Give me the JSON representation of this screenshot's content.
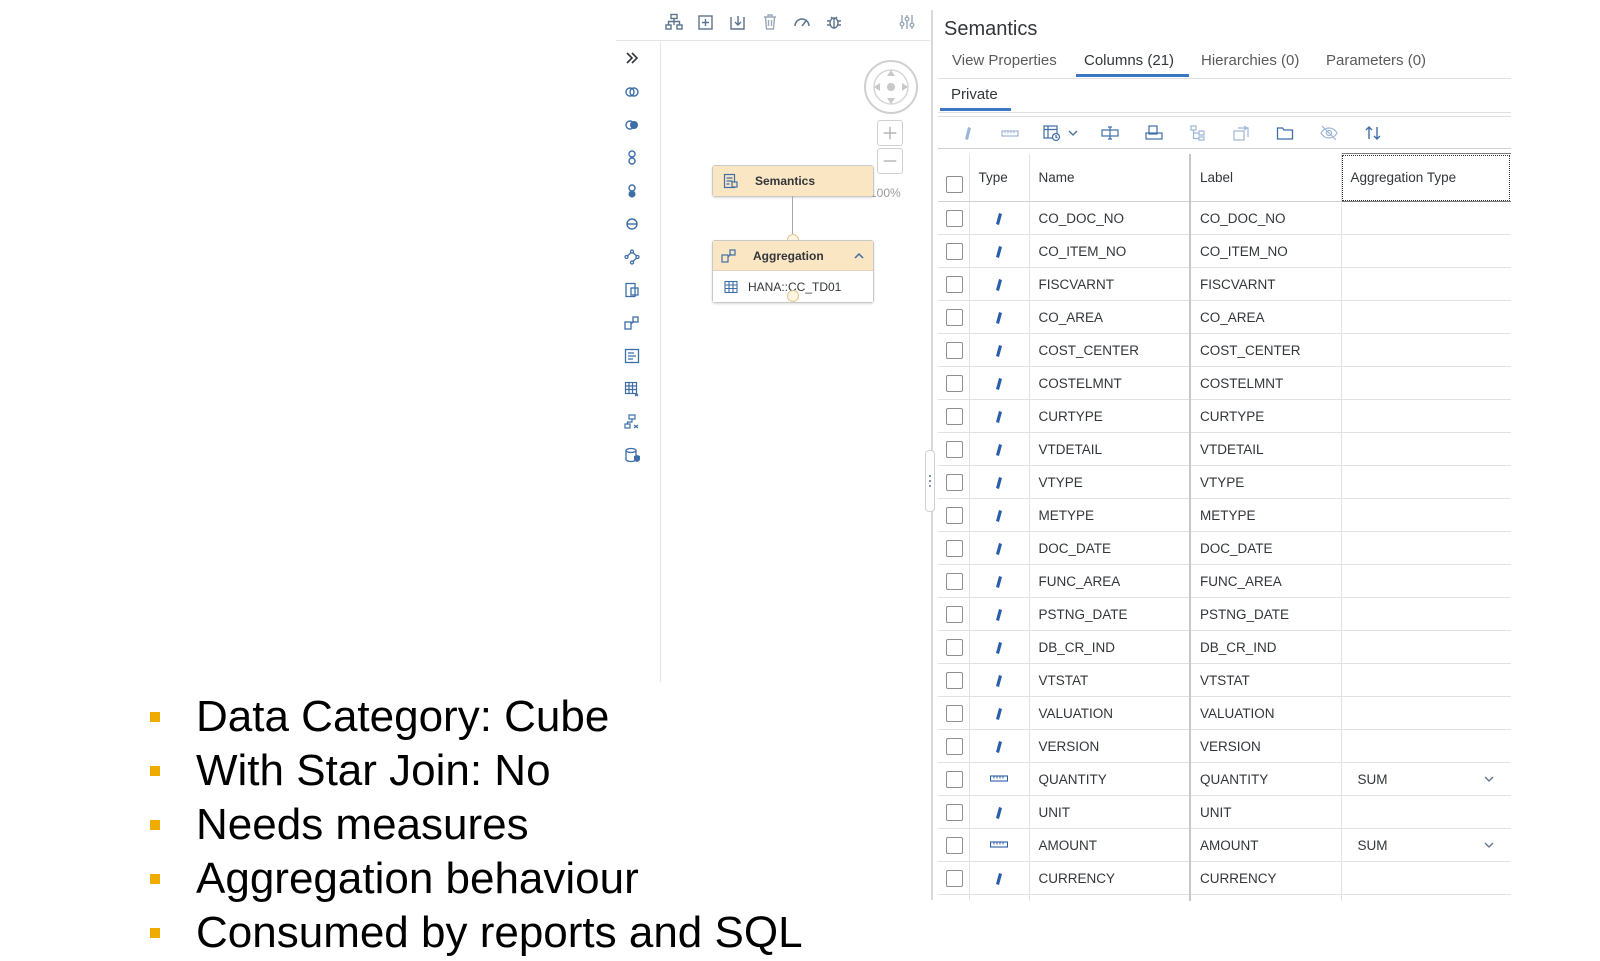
{
  "canvas": {
    "zoom": "100%",
    "toolbar_icons": [
      "hierarchy-icon",
      "add-node-icon",
      "remove-node-icon",
      "delete-icon",
      "performance-icon",
      "debug-icon",
      "settings-icon"
    ],
    "palette_icons": [
      "expand-icon",
      "join-icon",
      "union-icon",
      "graph-icon",
      "intersect-icon",
      "minus-icon",
      "non-equi-join-icon",
      "table-function-icon",
      "aggregation-icon",
      "rank-icon",
      "window-function-icon",
      "hierarchy-function-icon",
      "anonymization-icon"
    ],
    "nodes": {
      "semantics": {
        "label": "Semantics"
      },
      "aggregation": {
        "label": "Aggregation",
        "source": "HANA::CC_TD01"
      }
    }
  },
  "panel": {
    "title": "Semantics",
    "tabs": [
      "View Properties",
      "Columns (21)",
      "Hierarchies (0)",
      "Parameters (0)"
    ],
    "active_tab": 1,
    "subtab": "Private",
    "toolbar_icons": [
      "attribute-icon",
      "measure-icon",
      "calculated-column-icon",
      "chevron-down-icon",
      "rename-icon",
      "copy-icon",
      "hierarchy-icon",
      "propagate-icon",
      "folder-icon",
      "hide-icon",
      "sort-icon"
    ],
    "columns": {
      "headers": [
        "Type",
        "Name",
        "Label",
        "Aggregation Type"
      ],
      "rows": [
        {
          "type": "attribute",
          "name": "CO_DOC_NO",
          "label": "CO_DOC_NO",
          "agg": ""
        },
        {
          "type": "attribute",
          "name": "CO_ITEM_NO",
          "label": "CO_ITEM_NO",
          "agg": ""
        },
        {
          "type": "attribute",
          "name": "FISCVARNT",
          "label": "FISCVARNT",
          "agg": ""
        },
        {
          "type": "attribute",
          "name": "CO_AREA",
          "label": "CO_AREA",
          "agg": ""
        },
        {
          "type": "attribute",
          "name": "COST_CENTER",
          "label": "COST_CENTER",
          "agg": ""
        },
        {
          "type": "attribute",
          "name": "COSTELMNT",
          "label": "COSTELMNT",
          "agg": ""
        },
        {
          "type": "attribute",
          "name": "CURTYPE",
          "label": "CURTYPE",
          "agg": ""
        },
        {
          "type": "attribute",
          "name": "VTDETAIL",
          "label": "VTDETAIL",
          "agg": ""
        },
        {
          "type": "attribute",
          "name": "VTYPE",
          "label": "VTYPE",
          "agg": ""
        },
        {
          "type": "attribute",
          "name": "METYPE",
          "label": "METYPE",
          "agg": ""
        },
        {
          "type": "attribute",
          "name": "DOC_DATE",
          "label": "DOC_DATE",
          "agg": ""
        },
        {
          "type": "attribute",
          "name": "FUNC_AREA",
          "label": "FUNC_AREA",
          "agg": ""
        },
        {
          "type": "attribute",
          "name": "PSTNG_DATE",
          "label": "PSTNG_DATE",
          "agg": ""
        },
        {
          "type": "attribute",
          "name": "DB_CR_IND",
          "label": "DB_CR_IND",
          "agg": ""
        },
        {
          "type": "attribute",
          "name": "VTSTAT",
          "label": "VTSTAT",
          "agg": ""
        },
        {
          "type": "attribute",
          "name": "VALUATION",
          "label": "VALUATION",
          "agg": ""
        },
        {
          "type": "attribute",
          "name": "VERSION",
          "label": "VERSION",
          "agg": ""
        },
        {
          "type": "measure",
          "name": "QUANTITY",
          "label": "QUANTITY",
          "agg": "SUM"
        },
        {
          "type": "attribute",
          "name": "UNIT",
          "label": "UNIT",
          "agg": ""
        },
        {
          "type": "measure",
          "name": "AMOUNT",
          "label": "AMOUNT",
          "agg": "SUM"
        },
        {
          "type": "attribute",
          "name": "CURRENCY",
          "label": "CURRENCY",
          "agg": ""
        },
        {
          "type": "attribute",
          "name": "",
          "label": "",
          "agg": ""
        }
      ]
    }
  },
  "bullets": [
    "Data Category: Cube",
    "With Star Join: No",
    "Needs measures",
    "Aggregation behaviour",
    "Consumed by reports and SQL"
  ],
  "colors": {
    "accent": "#3a78c6",
    "node_header": "#fbe6c4",
    "bullet": "#f0ab00",
    "attribute_icon": "#2a5ea8"
  }
}
